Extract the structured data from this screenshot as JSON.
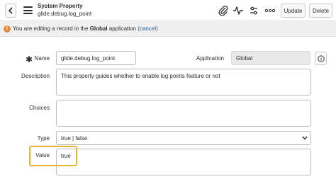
{
  "header": {
    "title": "System Property",
    "subtitle": "glide.debug.log_point",
    "update_label": "Update",
    "delete_label": "Delete",
    "icons": [
      "back-icon",
      "menu-icon",
      "attachment-icon",
      "activity-icon",
      "settings-icon",
      "more-icon"
    ]
  },
  "banner": {
    "prefix": "You are editing a record in the",
    "scope": "Global",
    "suffix": "application",
    "cancel": "(cancel)",
    "icon": "warning-icon",
    "icon_color": "#e8893a"
  },
  "form": {
    "name_label": "Name",
    "name_value": "glide.debug.log_point",
    "application_label": "Application",
    "application_value": "Global",
    "description_label": "Description",
    "description_value": "This property guides whether to enable log points feature or not",
    "choices_label": "Choices",
    "choices_value": "",
    "type_label": "Type",
    "type_value": "true | false",
    "value_label": "Value",
    "value_value": "true"
  },
  "colors": {
    "highlight": "#f0b429",
    "link": "#2b5c8a"
  }
}
